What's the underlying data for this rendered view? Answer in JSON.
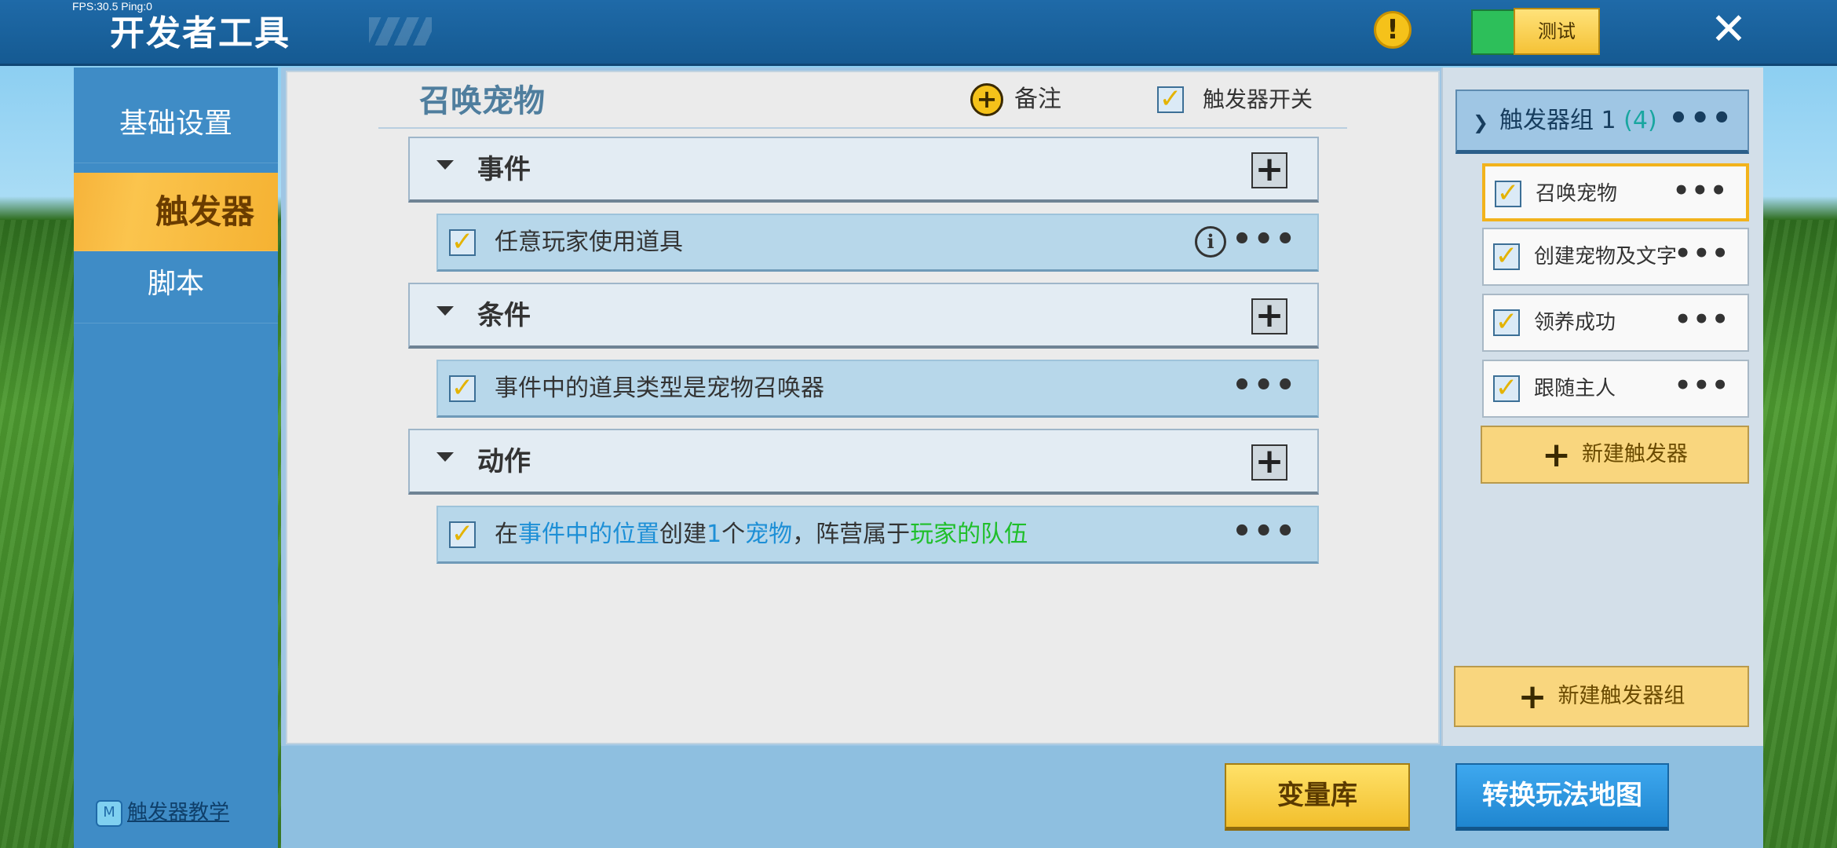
{
  "top": {
    "fps": "FPS:30.5  Ping:0",
    "title": "开发者工具",
    "warn_icon": "!",
    "test_label": "测试",
    "close_icon": "✕"
  },
  "sidebar": {
    "items": [
      {
        "label": "基础设置",
        "active": false
      },
      {
        "label": "触发器",
        "active": true
      },
      {
        "label": "脚本",
        "active": false
      }
    ],
    "tutorial": "触发器教学",
    "tutorial_icon": "book-icon"
  },
  "trigger": {
    "name": "召唤宠物",
    "note_label": "备注",
    "switch_label": "触发器开关",
    "switch_checked": true
  },
  "sections": {
    "event": {
      "label": "事件",
      "rows": [
        {
          "text": "任意玩家使用道具",
          "checked": true
        }
      ]
    },
    "condition": {
      "label": "条件",
      "rows": [
        {
          "text": "事件中的道具类型是宠物召唤器",
          "checked": true
        }
      ]
    },
    "action": {
      "label": "动作",
      "rows": [
        {
          "checked": true,
          "parts": [
            "在",
            "事件中的位置",
            "创建",
            "1",
            "个",
            "宠物",
            "，阵营属于",
            "玩家的队伍"
          ]
        }
      ]
    }
  },
  "group": {
    "title": "触发器组 1",
    "count": "(4)"
  },
  "triggers": [
    {
      "name": "召唤宠物",
      "checked": true,
      "selected": true
    },
    {
      "name": "创建宠物及文字",
      "checked": true,
      "selected": false
    },
    {
      "name": "领养成功",
      "checked": true,
      "selected": false
    },
    {
      "name": "跟随主人",
      "checked": true,
      "selected": false
    }
  ],
  "buttons": {
    "new_trigger": "新建触发器",
    "new_group": "新建触发器组",
    "variables": "变量库",
    "convert": "转换玩法地图"
  },
  "colors": {
    "accent_blue": "#1d8fd6",
    "accent_green": "#1fbf2a",
    "active_tab": "#fbc44d"
  }
}
